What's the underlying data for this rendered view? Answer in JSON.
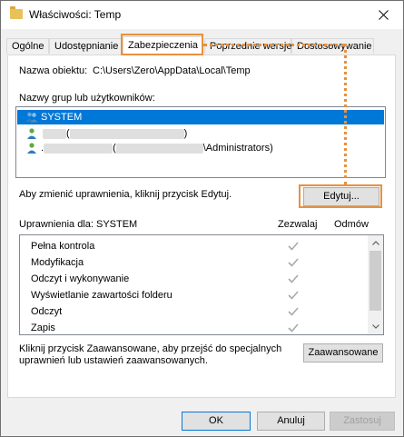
{
  "window": {
    "title": "Właściwości: Temp"
  },
  "tabs": [
    {
      "label": "Ogólne"
    },
    {
      "label": "Udostępnianie"
    },
    {
      "label": "Zabezpieczenia"
    },
    {
      "label": "Poprzednie wersje"
    },
    {
      "label": "Dostosowywanie"
    }
  ],
  "security": {
    "object_label": "Nazwa obiektu:",
    "object_value": "C:\\Users\\Zero\\AppData\\Local\\Temp",
    "groups_label": "Nazwy grup lub użytkowników:",
    "groups": [
      {
        "name": "SYSTEM",
        "selected": true
      },
      {
        "name": "(",
        "suffix": ")",
        "redacted": true
      },
      {
        "name": ".",
        "middle": "(",
        "suffix": "\\Administrators)",
        "redacted": true
      }
    ],
    "change_hint": "Aby zmienić uprawnienia, kliknij przycisk Edytuj.",
    "edit_button": "Edytuj...",
    "perm_label": "Uprawnienia dla: SYSTEM",
    "allow_header": "Zezwalaj",
    "deny_header": "Odmów",
    "permissions": [
      {
        "name": "Pełna kontrola",
        "allow": true,
        "deny": false
      },
      {
        "name": "Modyfikacja",
        "allow": true,
        "deny": false
      },
      {
        "name": "Odczyt i wykonywanie",
        "allow": true,
        "deny": false
      },
      {
        "name": "Wyświetlanie zawartości folderu",
        "allow": true,
        "deny": false
      },
      {
        "name": "Odczyt",
        "allow": true,
        "deny": false
      },
      {
        "name": "Zapis",
        "allow": true,
        "deny": false
      }
    ],
    "advanced_hint_1": "Kliknij przycisk Zaawansowane, aby przejść do specjalnych",
    "advanced_hint_2": "uprawnień lub ustawień zaawansowanych.",
    "advanced_button": "Zaawansowane"
  },
  "footer": {
    "ok": "OK",
    "cancel": "Anuluj",
    "apply": "Zastosuj"
  },
  "colors": {
    "accent": "#0078d7",
    "highlight": "#e8913d",
    "check": "#a9a9a9"
  }
}
